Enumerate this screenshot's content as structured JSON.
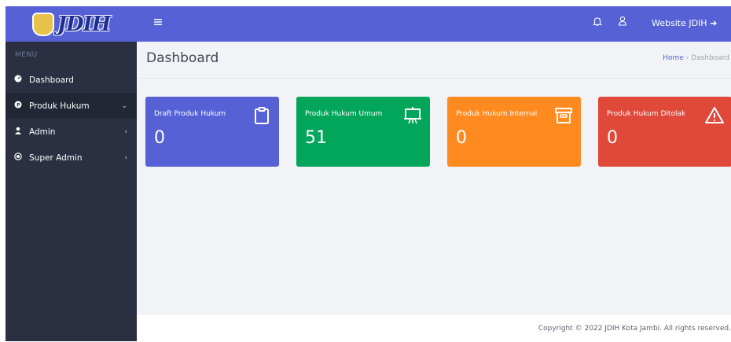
{
  "brand": {
    "logo_text": "JDIH"
  },
  "sidebar": {
    "menu_header": "MENU",
    "items": [
      {
        "label": "Dashboard",
        "icon": "dashboard-icon",
        "caret": ""
      },
      {
        "label": "Produk Hukum",
        "icon": "produk-hukum-icon",
        "caret": "⌄"
      },
      {
        "label": "Admin",
        "icon": "user-icon",
        "caret": "‹"
      },
      {
        "label": "Super Admin",
        "icon": "super-admin-icon",
        "caret": "‹"
      }
    ]
  },
  "topbar": {
    "website_link": "Website JDIH ➜"
  },
  "page": {
    "title": "Dashboard",
    "breadcrumb": {
      "home": "Home",
      "separator": " › ",
      "current": "Dashboard"
    }
  },
  "cards": [
    {
      "label": "Draft Produk Hukum",
      "value": "0",
      "color": "#5661d6",
      "icon": "clipboard-icon"
    },
    {
      "label": "Produk Hukum Umum",
      "value": "51",
      "color": "#02a65a",
      "icon": "presentation-icon"
    },
    {
      "label": "Produk Hukum Internal",
      "value": "0",
      "color": "#ff8a1f",
      "icon": "archive-icon"
    },
    {
      "label": "Produk Hukum Ditolak",
      "value": "0",
      "color": "#e0483a",
      "icon": "warning-icon"
    }
  ],
  "footer": {
    "copyright": "Copyright © 2022 JDIH Kota Jambi. All rights reserved."
  }
}
